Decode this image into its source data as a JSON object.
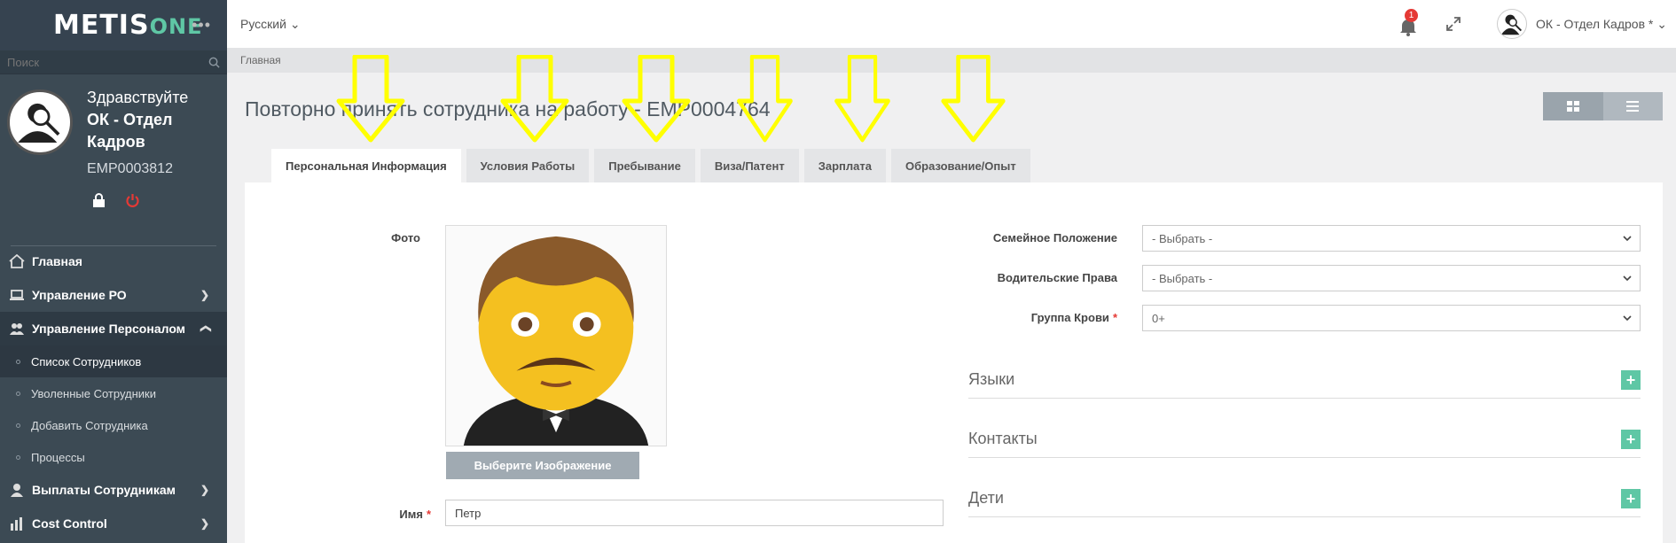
{
  "app": {
    "logo_main": "METIS",
    "logo_accent": "ONE",
    "more_label": "•••"
  },
  "sidebar": {
    "search_placeholder": "Поиск",
    "greeting": "Здравствуйте",
    "user_name": "ОК - Отдел Кадров",
    "employee_id": "EMP0003812",
    "menu": [
      {
        "label": "Главная"
      },
      {
        "label": "Управление РО"
      },
      {
        "label": "Управление Персоналом"
      },
      {
        "label": "Выплаты Сотрудникам"
      },
      {
        "label": "Cost Control"
      }
    ],
    "submenu": [
      {
        "label": "Список Сотрудников"
      },
      {
        "label": "Уволенные Сотрудники"
      },
      {
        "label": "Добавить Сотрудника"
      },
      {
        "label": "Процессы"
      }
    ]
  },
  "topbar": {
    "language": "Русский",
    "notification_count": "1",
    "user_label": "ОК - Отдел Кадров *"
  },
  "breadcrumb": "Главная",
  "page": {
    "title": "Повторно принять сотрудника на работу - EMP0004764"
  },
  "tabs": [
    {
      "label": "Персональная Информация"
    },
    {
      "label": "Условия Работы"
    },
    {
      "label": "Пребывание"
    },
    {
      "label": "Виза/Патент"
    },
    {
      "label": "Зарплата"
    },
    {
      "label": "Образование/Опыт"
    }
  ],
  "form": {
    "photo_label": "Фото",
    "choose_image": "Выберите Изображение",
    "first_name_label": "Имя",
    "first_name_value": "Петр",
    "marital_label": "Семейное Положение",
    "marital_value": "- Выбрать -",
    "license_label": "Водительские Права",
    "license_value": "- Выбрать -",
    "blood_label": "Группа Крови",
    "blood_value": "0+"
  },
  "sections": [
    {
      "title": "Языки"
    },
    {
      "title": "Контакты"
    },
    {
      "title": "Дети"
    }
  ],
  "colors": {
    "accent": "#5fc7a5",
    "sidebar": "#3c4a54",
    "required": "#e53935",
    "annotation_arrow": "#ffff00"
  }
}
